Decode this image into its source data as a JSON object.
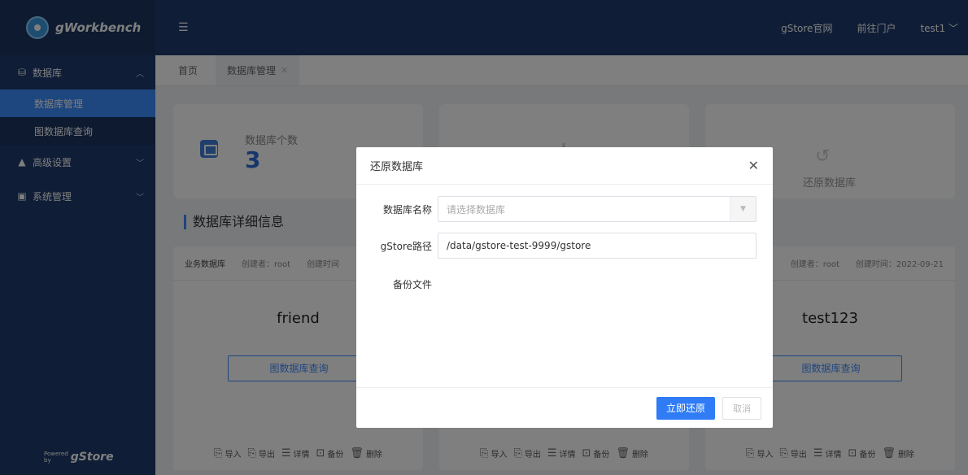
{
  "app": {
    "logo_text": "gWorkbench",
    "powered_small_1": "Powered",
    "powered_small_2": "by",
    "powered_brand": "gStore"
  },
  "sidebar": {
    "groups": [
      {
        "label": "数据库",
        "icon": "database-icon",
        "expanded": true,
        "items": [
          {
            "label": "数据库管理",
            "active": true
          },
          {
            "label": "图数据库查询",
            "active": false
          }
        ]
      },
      {
        "label": "高级设置",
        "icon": "settings-icon",
        "expanded": false
      },
      {
        "label": "系统管理",
        "icon": "system-icon",
        "expanded": false
      }
    ]
  },
  "header": {
    "links": [
      "gStore官网",
      "前往门户"
    ],
    "user": "test1"
  },
  "tabs": {
    "home": "首页",
    "current": "数据库管理"
  },
  "stats": {
    "count_label": "数据库个数",
    "count_value": "3",
    "restore_label": "还原数据库"
  },
  "section_title": "数据库详细信息",
  "db_cards": [
    {
      "type": "业务数据库",
      "creator": "创建者：root",
      "created": "创建时间",
      "name": "friend",
      "query_label": "图数据库查询"
    },
    {
      "type": "",
      "creator": "",
      "created": "",
      "name": "",
      "query_label": ""
    },
    {
      "type": "",
      "creator": "创建者：root",
      "created": "创建时间：2022-09-21",
      "name": "test123",
      "query_label": "图数据库查询"
    }
  ],
  "card_actions": [
    "导入",
    "导出",
    "详情",
    "备份",
    "删除"
  ],
  "modal": {
    "title": "还原数据库",
    "db_name_label": "数据库名称",
    "db_name_placeholder": "请选择数据库",
    "path_label": "gStore路径",
    "path_value": "/data/gstore-test-9999/gstore",
    "backup_label": "备份文件",
    "confirm_label": "立即还原",
    "cancel_label": "取消"
  },
  "colors": {
    "sidebar_bg": "#1f3b6c",
    "active_item": "#3d8cff",
    "primary_button": "#2f7cf6"
  }
}
